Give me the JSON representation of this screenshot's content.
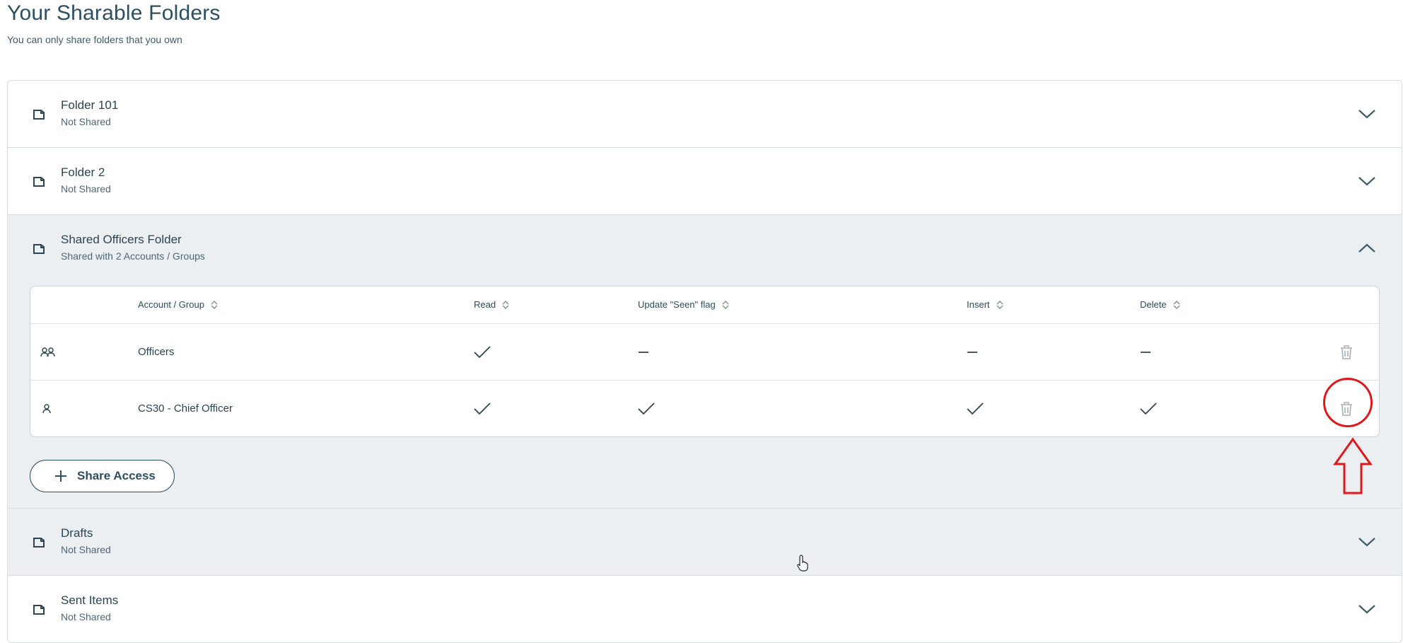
{
  "page": {
    "title": "Your Sharable Folders",
    "subtitle": "You can only share folders that you own"
  },
  "folders": [
    {
      "name": "Folder 101",
      "status": "Not Shared",
      "icon": "folder-icon",
      "chevron": "chevron-down-icon"
    },
    {
      "name": "Folder 2",
      "status": "Not Shared",
      "icon": "folder-icon",
      "chevron": "chevron-down-icon"
    },
    {
      "name": "Shared Officers Folder",
      "status": "Shared with 2 Accounts / Groups",
      "icon": "folder-icon",
      "chevron": "chevron-up-icon"
    },
    {
      "name": "Drafts",
      "status": "Not Shared",
      "icon": "folder-icon",
      "chevron": "chevron-down-icon"
    },
    {
      "name": "Sent Items",
      "status": "Not Shared",
      "icon": "folder-icon",
      "chevron": "chevron-down-icon"
    }
  ],
  "share_table": {
    "columns": [
      "Account / Group",
      "Read",
      "Update \"Seen\" flag",
      "Insert",
      "Delete"
    ],
    "rows": [
      {
        "type": "group-icon",
        "name": "Officers",
        "read": "check",
        "seen": "dash",
        "insert": "dash",
        "delete": "dash"
      },
      {
        "type": "user-icon",
        "name": "CS30 - Chief Officer",
        "read": "check",
        "seen": "check",
        "insert": "check",
        "delete": "check"
      }
    ]
  },
  "share_button": {
    "label": "Share Access",
    "icon": "plus-icon"
  },
  "colors": {
    "accent": "#2c4f63",
    "expanded_background": "#ebeff2",
    "annotation": "#e0181b"
  }
}
